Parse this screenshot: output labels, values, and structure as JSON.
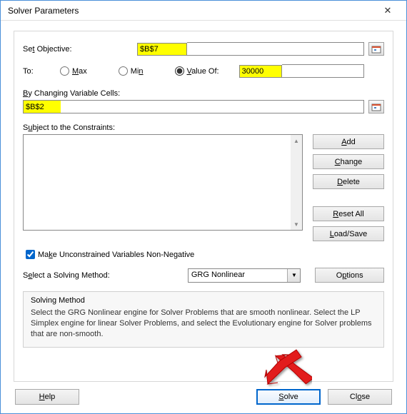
{
  "window": {
    "title": "Solver Parameters"
  },
  "objective": {
    "label": "Set Objective:",
    "value": "$B$7"
  },
  "to": {
    "label": "To:",
    "max": "Max",
    "min": "Min",
    "valueof": "Value Of:",
    "value": "30000",
    "selected": "valueof"
  },
  "cells": {
    "label": "By Changing Variable Cells:",
    "value": "$B$2"
  },
  "constraints": {
    "label": "Subject to the Constraints:",
    "add": "Add",
    "change": "Change",
    "delete": "Delete",
    "reset": "Reset All",
    "loadsave": "Load/Save"
  },
  "unconstrained": {
    "label": "Make Unconstrained Variables Non-Negative",
    "checked": true
  },
  "method": {
    "label": "Select a Solving Method:",
    "selected": "GRG Nonlinear",
    "options_btn": "Options"
  },
  "info": {
    "title": "Solving Method",
    "text": "Select the GRG Nonlinear engine for Solver Problems that are smooth nonlinear. Select the LP Simplex engine for linear Solver Problems, and select the Evolutionary engine for Solver problems that are non-smooth."
  },
  "footer": {
    "help": "Help",
    "solve": "Solve",
    "close": "Close"
  }
}
